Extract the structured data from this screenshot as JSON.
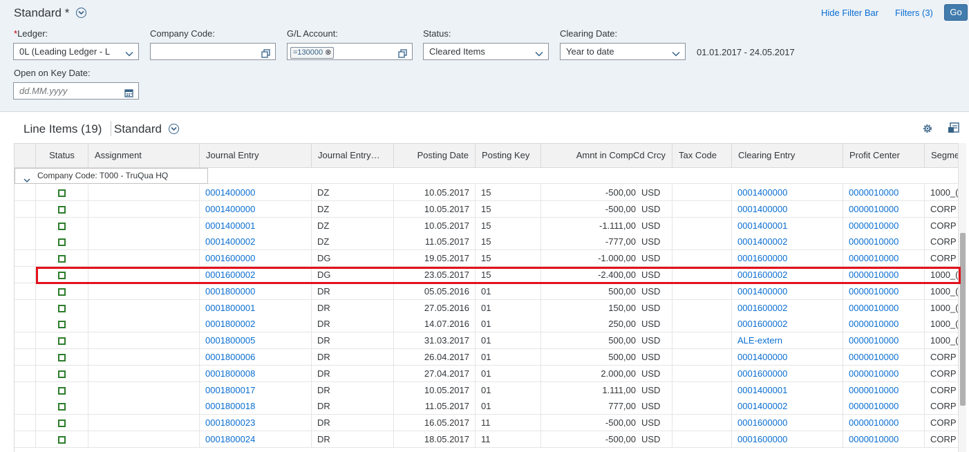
{
  "filter_bar": {
    "variant_title": "Standard *",
    "hide_filter_bar": "Hide Filter Bar",
    "filters": "Filters (3)",
    "go": "Go",
    "ledger": {
      "label": "Ledger:",
      "required_mark": "*",
      "value": "0L (Leading Ledger - L"
    },
    "company_code": {
      "label": "Company Code:",
      "value": ""
    },
    "gl_account": {
      "label": "G/L Account:",
      "token": "=130000"
    },
    "status": {
      "label": "Status:",
      "value": "Cleared Items"
    },
    "clearing_date": {
      "label": "Clearing Date:",
      "value": "Year to date",
      "range": "01.01.2017 - 24.05.2017"
    },
    "key_date": {
      "label": "Open on Key Date:",
      "placeholder": "dd.MM.yyyy"
    }
  },
  "table": {
    "title": "Line Items (19)",
    "variant": "Standard",
    "columns": [
      "Status",
      "Assignment",
      "Journal Entry",
      "Journal Entry…",
      "Posting Date",
      "Posting Key",
      "Amnt in CompCd Crcy",
      "Tax Code",
      "Clearing Entry",
      "Profit Center",
      "Segme"
    ],
    "group_label": "Company Code: T000 - TruQua HQ",
    "highlighted_row_index": 5,
    "rows": [
      {
        "journal_entry": "0001400000",
        "je_type": "DZ",
        "posting_date": "10.05.2017",
        "posting_key": "15",
        "amount": "-500,00",
        "currency": "USD",
        "clearing_entry": "0001400000",
        "profit_center": "0000010000",
        "segment": "1000_("
      },
      {
        "journal_entry": "0001400000",
        "je_type": "DZ",
        "posting_date": "10.05.2017",
        "posting_key": "15",
        "amount": "-500,00",
        "currency": "USD",
        "clearing_entry": "0001400000",
        "profit_center": "0000010000",
        "segment": "CORP"
      },
      {
        "journal_entry": "0001400001",
        "je_type": "DZ",
        "posting_date": "10.05.2017",
        "posting_key": "15",
        "amount": "-1.111,00",
        "currency": "USD",
        "clearing_entry": "0001400001",
        "profit_center": "0000010000",
        "segment": "CORP"
      },
      {
        "journal_entry": "0001400002",
        "je_type": "DZ",
        "posting_date": "11.05.2017",
        "posting_key": "15",
        "amount": "-777,00",
        "currency": "USD",
        "clearing_entry": "0001400002",
        "profit_center": "0000010000",
        "segment": "CORP"
      },
      {
        "journal_entry": "0001600000",
        "je_type": "DG",
        "posting_date": "19.05.2017",
        "posting_key": "15",
        "amount": "-1.000,00",
        "currency": "USD",
        "clearing_entry": "0001600000",
        "profit_center": "0000010000",
        "segment": "CORP"
      },
      {
        "journal_entry": "0001600002",
        "je_type": "DG",
        "posting_date": "23.05.2017",
        "posting_key": "15",
        "amount": "-2.400,00",
        "currency": "USD",
        "clearing_entry": "0001600002",
        "profit_center": "0000010000",
        "segment": "1000_("
      },
      {
        "journal_entry": "0001800000",
        "je_type": "DR",
        "posting_date": "05.05.2016",
        "posting_key": "01",
        "amount": "500,00",
        "currency": "USD",
        "clearing_entry": "0001400000",
        "profit_center": "0000010000",
        "segment": "1000_("
      },
      {
        "journal_entry": "0001800001",
        "je_type": "DR",
        "posting_date": "27.05.2016",
        "posting_key": "01",
        "amount": "150,00",
        "currency": "USD",
        "clearing_entry": "0001600002",
        "profit_center": "0000010000",
        "segment": "1000_("
      },
      {
        "journal_entry": "0001800002",
        "je_type": "DR",
        "posting_date": "14.07.2016",
        "posting_key": "01",
        "amount": "250,00",
        "currency": "USD",
        "clearing_entry": "0001600002",
        "profit_center": "0000010000",
        "segment": "1000_("
      },
      {
        "journal_entry": "0001800005",
        "je_type": "DR",
        "posting_date": "31.03.2017",
        "posting_key": "01",
        "amount": "500,00",
        "currency": "USD",
        "clearing_entry": "ALE-extern",
        "profit_center": "0000010000",
        "segment": "1000_("
      },
      {
        "journal_entry": "0001800006",
        "je_type": "DR",
        "posting_date": "26.04.2017",
        "posting_key": "01",
        "amount": "500,00",
        "currency": "USD",
        "clearing_entry": "0001400000",
        "profit_center": "0000010000",
        "segment": "CORP"
      },
      {
        "journal_entry": "0001800008",
        "je_type": "DR",
        "posting_date": "27.04.2017",
        "posting_key": "01",
        "amount": "2.000,00",
        "currency": "USD",
        "clearing_entry": "0001600000",
        "profit_center": "0000010000",
        "segment": "CORP"
      },
      {
        "journal_entry": "0001800017",
        "je_type": "DR",
        "posting_date": "10.05.2017",
        "posting_key": "01",
        "amount": "1.111,00",
        "currency": "USD",
        "clearing_entry": "0001400001",
        "profit_center": "0000010000",
        "segment": "CORP"
      },
      {
        "journal_entry": "0001800018",
        "je_type": "DR",
        "posting_date": "11.05.2017",
        "posting_key": "01",
        "amount": "777,00",
        "currency": "USD",
        "clearing_entry": "0001400002",
        "profit_center": "0000010000",
        "segment": "CORP"
      },
      {
        "journal_entry": "0001800023",
        "je_type": "DR",
        "posting_date": "16.05.2017",
        "posting_key": "11",
        "amount": "-500,00",
        "currency": "USD",
        "clearing_entry": "0001600000",
        "profit_center": "0000010000",
        "segment": "CORP"
      },
      {
        "journal_entry": "0001800024",
        "je_type": "DR",
        "posting_date": "18.05.2017",
        "posting_key": "11",
        "amount": "-500,00",
        "currency": "USD",
        "clearing_entry": "0001600000",
        "profit_center": "0000010000",
        "segment": "CORP"
      }
    ]
  },
  "icons": {
    "variant": "chevron-down-circle-icon",
    "value_help": "value-help-icon",
    "dropdown": "chevron-down-icon",
    "calendar": "calendar-icon",
    "settings": "gear-icon",
    "export": "export-icon",
    "status": "status-square-icon"
  },
  "colors": {
    "link": "#0a6ed1",
    "status": "#2b7d2b",
    "highlight": "#e3111b",
    "go_button": "#427cac"
  }
}
